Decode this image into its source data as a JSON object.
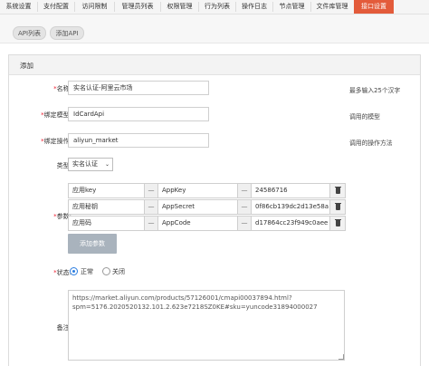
{
  "nav": {
    "tabs": [
      "系统设置",
      "支付配置",
      "访问限制",
      "管理员列表",
      "权限管理",
      "行为列表",
      "操作日志",
      "节点管理",
      "文件库管理",
      "接口设置"
    ],
    "active_index": 9
  },
  "subbar": {
    "api_list": "API列表",
    "add_api": "添加API"
  },
  "panel": {
    "title": "添加"
  },
  "form": {
    "name": {
      "label": "名称:",
      "value": "实名认证-阿里云市场",
      "hint": "最多输入25个汉字"
    },
    "model": {
      "label": "绑定模型:",
      "value": "IdCardApi",
      "hint": "调用的模型"
    },
    "action": {
      "label": "绑定操作:",
      "value": "aliyun_market",
      "hint": "调用的操作方法"
    },
    "type": {
      "label": "类型:",
      "value": "实名认证"
    },
    "params": {
      "label": "参数:",
      "rows": [
        {
          "name": "应用key",
          "key": "AppKey",
          "value": "24586716"
        },
        {
          "name": "应用秘钥",
          "key": "AppSecret",
          "value": "0f86cb139dc2d13e58a"
        },
        {
          "name": "应用码",
          "key": "AppCode",
          "value": "d17864cc23f949c0aee"
        }
      ],
      "sep": "—",
      "add_label": "添加参数"
    },
    "status": {
      "label": "状态:",
      "on_label": "正常",
      "off_label": "关闭",
      "selected": "正常"
    },
    "remark": {
      "label": "备注:",
      "value": "https://market.aliyun.com/products/57126001/cmapi00037894.html?\nspm=5176.2020520132.101.2.623e7218SZ0KE#sku=yuncode31894000027"
    }
  }
}
